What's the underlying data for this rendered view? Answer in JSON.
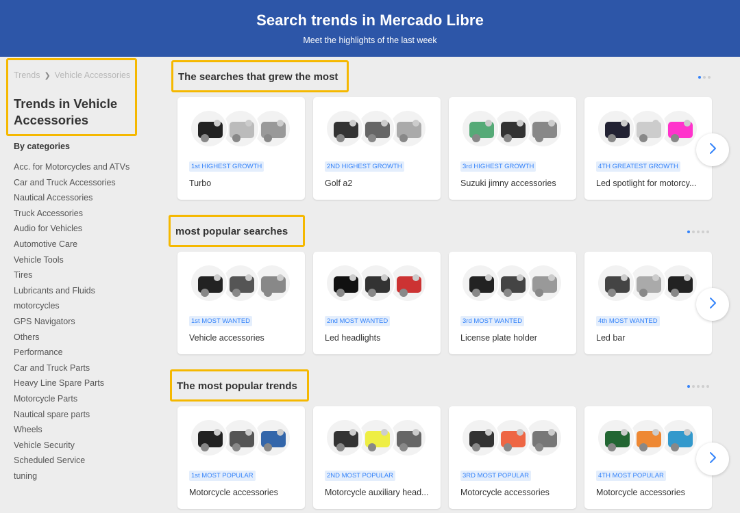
{
  "header": {
    "title": "Search trends in Mercado Libre",
    "subtitle": "Meet the highlights of the last week"
  },
  "sidebar": {
    "breadcrumb": [
      "Trends",
      "Vehicle Accessories"
    ],
    "title": "Trends in Vehicle Accessories",
    "categories_label": "By categories",
    "categories": [
      "Acc. for Motorcycles and ATVs",
      "Car and Truck Accessories",
      "Nautical Accessories",
      "Truck Accessories",
      "Audio for Vehicles",
      "Automotive Care",
      "Vehicle Tools",
      "Tires",
      "Lubricants and Fluids",
      "motorcycles",
      "GPS Navigators",
      "Others",
      "Performance",
      "Car and Truck Parts",
      "Heavy Line Spare Parts",
      "Motorcycle Parts",
      "Nautical spare parts",
      "Wheels",
      "Vehicle Security",
      "Scheduled Service",
      "tuning"
    ]
  },
  "sections": [
    {
      "title": "The searches that grew the most",
      "dots": 3,
      "cards": [
        {
          "tag": "1st HIGHEST GROWTH",
          "name": "Turbo"
        },
        {
          "tag": "2ND HIGHEST GROWTH",
          "name": "Golf a2"
        },
        {
          "tag": "3rd HIGHEST GROWTH",
          "name": "Suzuki jimny accessories"
        },
        {
          "tag": "4TH GREATEST GROWTH",
          "name": "Led spotlight for motorcy..."
        }
      ]
    },
    {
      "title": "most popular searches",
      "dots": 5,
      "cards": [
        {
          "tag": "1st MOST WANTED",
          "name": "Vehicle accessories"
        },
        {
          "tag": "2nd MOST WANTED",
          "name": "Led headlights"
        },
        {
          "tag": "3rd MOST WANTED",
          "name": "License plate holder"
        },
        {
          "tag": "4th MOST WANTED",
          "name": "Led bar"
        }
      ]
    },
    {
      "title": "The most popular trends",
      "dots": 5,
      "cards": [
        {
          "tag": "1st MOST POPULAR",
          "name": "Motorcycle accessories"
        },
        {
          "tag": "2ND MOST POPULAR",
          "name": "Motorcycle auxiliary head..."
        },
        {
          "tag": "3RD MOST POPULAR",
          "name": "Motorcycle accessories"
        },
        {
          "tag": "4TH MOST POPULAR",
          "name": "Motorcycle accessories"
        }
      ]
    }
  ],
  "colors": {
    "header": "#2d56a8",
    "highlight": "#f5b800",
    "accent": "#3483fa"
  },
  "icons": {
    "next": "chevron-right-icon",
    "thumb": "product-thumbnail"
  }
}
